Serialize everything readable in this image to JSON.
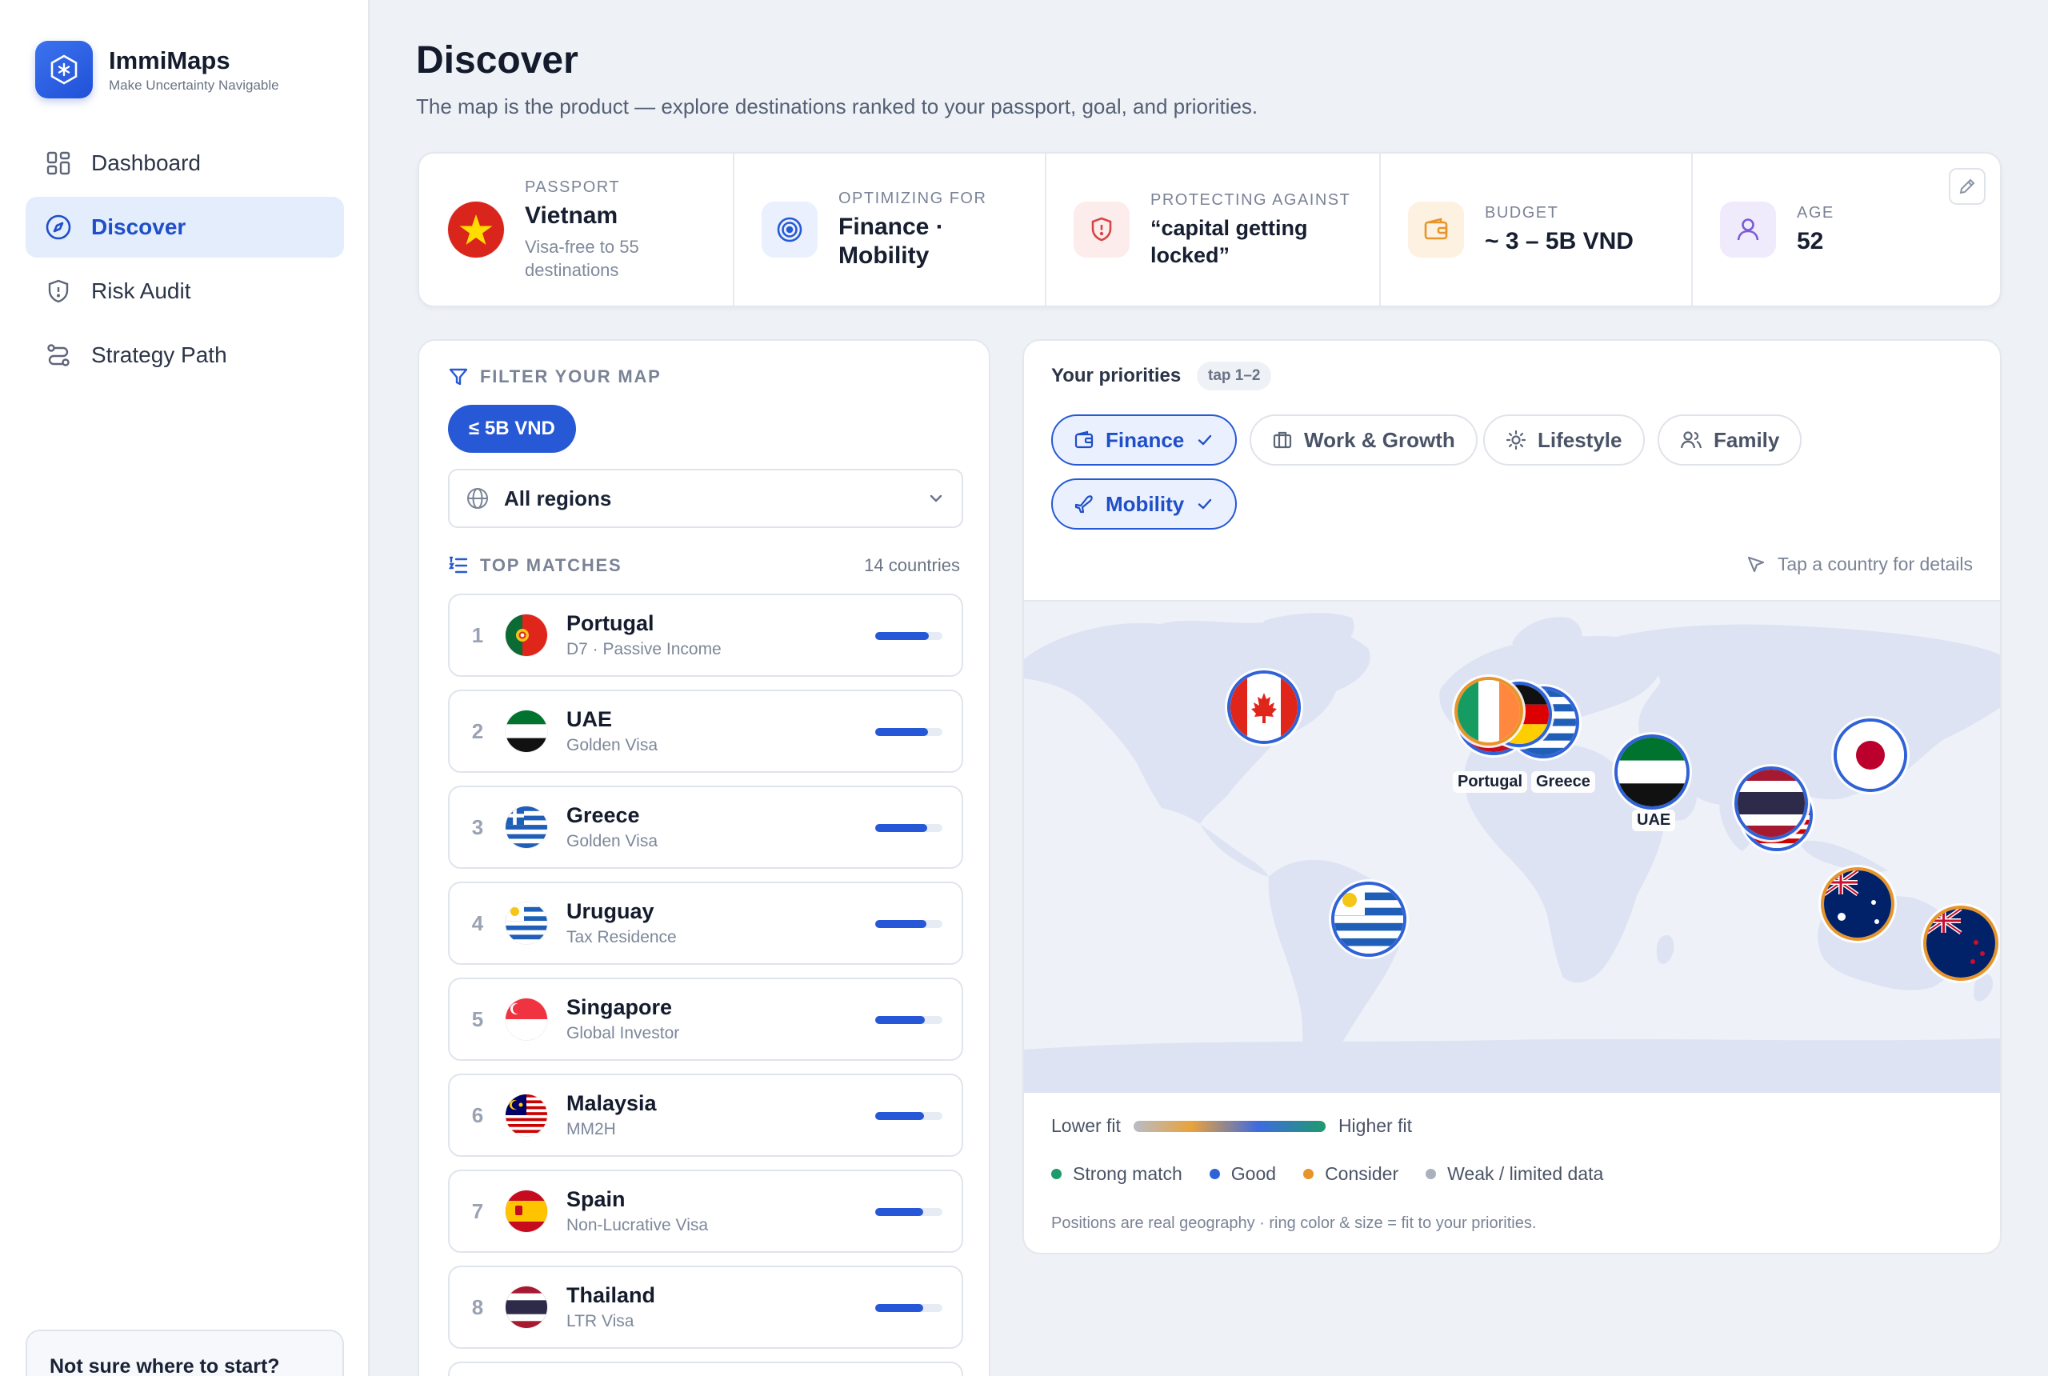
{
  "brand": {
    "name": "ImmiMaps",
    "tagline": "Make Uncertainty Navigable"
  },
  "nav": [
    {
      "label": "Dashboard",
      "icon": "dashboard-icon",
      "active": false
    },
    {
      "label": "Discover",
      "icon": "compass-icon",
      "active": true
    },
    {
      "label": "Risk Audit",
      "icon": "shield-icon",
      "active": false
    },
    {
      "label": "Strategy Path",
      "icon": "route-icon",
      "active": false
    }
  ],
  "help": {
    "title": "Not sure where to start?"
  },
  "page": {
    "title": "Discover",
    "subtitle": "The map is the product — explore destinations ranked to your passport, goal, and priorities."
  },
  "profile": {
    "passport": {
      "label": "PASSPORT",
      "value": "Vietnam",
      "note": "Visa-free to 55 destinations"
    },
    "optimizing": {
      "label": "OPTIMIZING FOR",
      "value": "Finance · Mobility"
    },
    "protecting": {
      "label": "PROTECTING AGAINST",
      "value": "“capital getting locked”"
    },
    "budget": {
      "label": "BUDGET",
      "value": "~ 3 – 5B VND"
    },
    "age": {
      "label": "AGE",
      "value": "52"
    },
    "colors": {
      "optimizing": "#eaf0fd",
      "protecting": "#fdecec",
      "budget": "#fdf1e1",
      "age": "#efeafc"
    }
  },
  "filter": {
    "label": "FILTER YOUR MAP",
    "budget_chip": "≤ 5B VND",
    "region": "All regions"
  },
  "matches": {
    "label": "TOP MATCHES",
    "count": "14 countries",
    "items": [
      {
        "rank": "1",
        "name": "Portugal",
        "visa": "D7 · Passive Income",
        "fit": 0.8
      },
      {
        "rank": "2",
        "name": "UAE",
        "visa": "Golden Visa",
        "fit": 0.78
      },
      {
        "rank": "3",
        "name": "Greece",
        "visa": "Golden Visa",
        "fit": 0.77
      },
      {
        "rank": "4",
        "name": "Uruguay",
        "visa": "Tax Residence",
        "fit": 0.76
      },
      {
        "rank": "5",
        "name": "Singapore",
        "visa": "Global Investor",
        "fit": 0.74
      },
      {
        "rank": "6",
        "name": "Malaysia",
        "visa": "MM2H",
        "fit": 0.73
      },
      {
        "rank": "7",
        "name": "Spain",
        "visa": "Non-Lucrative Visa",
        "fit": 0.72
      },
      {
        "rank": "8",
        "name": "Thailand",
        "visa": "LTR Visa",
        "fit": 0.71
      }
    ]
  },
  "priorities": {
    "title": "Your priorities",
    "badge": "tap 1–2",
    "chips": [
      {
        "label": "Finance",
        "icon": "wallet-icon",
        "selected": true
      },
      {
        "label": "Work & Growth",
        "icon": "briefcase-icon",
        "selected": false
      },
      {
        "label": "Lifestyle",
        "icon": "sun-icon",
        "selected": false
      },
      {
        "label": "Family",
        "icon": "family-icon",
        "selected": false
      },
      {
        "label": "Mobility",
        "icon": "plane-icon",
        "selected": true
      }
    ],
    "hint": "Tap a country for details"
  },
  "map": {
    "labels": {
      "portugal": "Portugal",
      "greece": "Greece",
      "uae": "UAE"
    }
  },
  "legend": {
    "lower": "Lower fit",
    "higher": "Higher fit",
    "items": [
      {
        "label": "Strong match",
        "color": "#1e9b6d"
      },
      {
        "label": "Good",
        "color": "#2f62d6"
      },
      {
        "label": "Consider",
        "color": "#e7952a"
      },
      {
        "label": "Weak / limited data",
        "color": "#aab1bd"
      }
    ],
    "note": "Positions are real geography · ring color & size = fit to your priorities."
  },
  "colors": {
    "accent": "#2759d6",
    "background": "#eef1f6"
  }
}
